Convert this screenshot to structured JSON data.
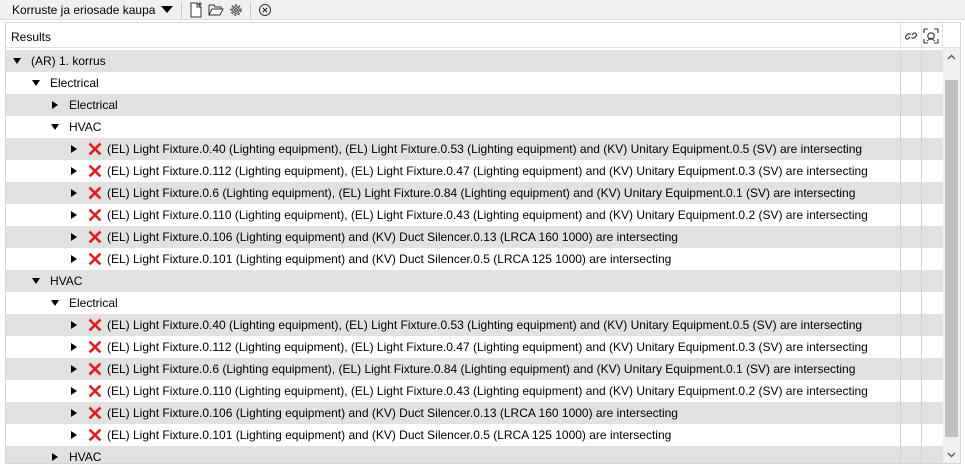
{
  "toolbar": {
    "combo_label": "Korruste ja eriosade kaupa",
    "buttons": [
      "new-file-icon",
      "open-folder-icon",
      "settings-gear-icon",
      "close-circle-icon"
    ]
  },
  "panel": {
    "header_title": "Results",
    "header_icons": [
      "link-icon",
      "focus-frame-icon"
    ]
  },
  "colors": {
    "shade_row": "#e1e1e1",
    "error_red": "#e02020",
    "scroll_thumb": "#c1c1c1"
  },
  "rows": [
    {
      "indent": 0,
      "expander": "down",
      "error": false,
      "text": "(AR) 1. korrus"
    },
    {
      "indent": 1,
      "expander": "down",
      "error": false,
      "text": "Electrical"
    },
    {
      "indent": 2,
      "expander": "right",
      "error": false,
      "text": "Electrical"
    },
    {
      "indent": 2,
      "expander": "down",
      "error": false,
      "text": "HVAC"
    },
    {
      "indent": 3,
      "expander": "right",
      "error": true,
      "text": "(EL) Light Fixture.0.40 (Lighting equipment), (EL) Light Fixture.0.53 (Lighting equipment) and (KV) Unitary Equipment.0.5 (SV) are intersecting"
    },
    {
      "indent": 3,
      "expander": "right",
      "error": true,
      "text": "(EL) Light Fixture.0.112 (Lighting equipment), (EL) Light Fixture.0.47 (Lighting equipment) and (KV) Unitary Equipment.0.3 (SV) are intersecting"
    },
    {
      "indent": 3,
      "expander": "right",
      "error": true,
      "text": "(EL) Light Fixture.0.6 (Lighting equipment), (EL) Light Fixture.0.84 (Lighting equipment) and (KV) Unitary Equipment.0.1 (SV) are intersecting"
    },
    {
      "indent": 3,
      "expander": "right",
      "error": true,
      "text": "(EL) Light Fixture.0.110 (Lighting equipment), (EL) Light Fixture.0.43 (Lighting equipment) and (KV) Unitary Equipment.0.2 (SV) are intersecting"
    },
    {
      "indent": 3,
      "expander": "right",
      "error": true,
      "text": "(EL) Light Fixture.0.106 (Lighting equipment) and (KV) Duct Silencer.0.13 (LRCA 160 1000) are intersecting"
    },
    {
      "indent": 3,
      "expander": "right",
      "error": true,
      "text": "(EL) Light Fixture.0.101 (Lighting equipment) and (KV) Duct Silencer.0.5 (LRCA 125 1000) are intersecting"
    },
    {
      "indent": 1,
      "expander": "down",
      "error": false,
      "text": "HVAC"
    },
    {
      "indent": 2,
      "expander": "down",
      "error": false,
      "text": "Electrical"
    },
    {
      "indent": 3,
      "expander": "right",
      "error": true,
      "text": "(EL) Light Fixture.0.40 (Lighting equipment), (EL) Light Fixture.0.53 (Lighting equipment) and (KV) Unitary Equipment.0.5 (SV) are intersecting"
    },
    {
      "indent": 3,
      "expander": "right",
      "error": true,
      "text": "(EL) Light Fixture.0.112 (Lighting equipment), (EL) Light Fixture.0.47 (Lighting equipment) and (KV) Unitary Equipment.0.3 (SV) are intersecting"
    },
    {
      "indent": 3,
      "expander": "right",
      "error": true,
      "text": "(EL) Light Fixture.0.6 (Lighting equipment), (EL) Light Fixture.0.84 (Lighting equipment) and (KV) Unitary Equipment.0.1 (SV) are intersecting"
    },
    {
      "indent": 3,
      "expander": "right",
      "error": true,
      "text": "(EL) Light Fixture.0.110 (Lighting equipment), (EL) Light Fixture.0.43 (Lighting equipment) and (KV) Unitary Equipment.0.2 (SV) are intersecting"
    },
    {
      "indent": 3,
      "expander": "right",
      "error": true,
      "text": "(EL) Light Fixture.0.106 (Lighting equipment) and (KV) Duct Silencer.0.13 (LRCA 160 1000) are intersecting"
    },
    {
      "indent": 3,
      "expander": "right",
      "error": true,
      "text": "(EL) Light Fixture.0.101 (Lighting equipment) and (KV) Duct Silencer.0.5 (LRCA 125 1000) are intersecting"
    },
    {
      "indent": 2,
      "expander": "right",
      "error": false,
      "text": "HVAC"
    }
  ]
}
